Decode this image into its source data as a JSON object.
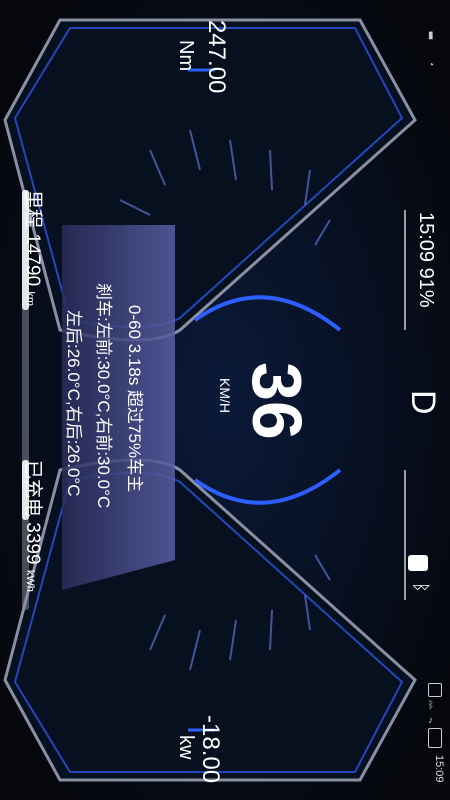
{
  "status_bar": {
    "time": "15:09",
    "icons": [
      "nfc-icon",
      "bluetooth-icon",
      "mute-icon",
      "battery-icon",
      "signal-icon",
      "alarm-icon"
    ]
  },
  "dash": {
    "time_battery": "15:09 91%",
    "gear": "D",
    "speed": "36",
    "speed_unit": "KM/H",
    "torque_value": "247.00",
    "torque_unit": "Nm",
    "power_value": "-18.00",
    "power_unit": "kw",
    "odometer_label": "里程",
    "odometer_value": "14790",
    "odometer_unit": "km",
    "charged_label": "已充电",
    "charged_value": "3399",
    "charged_unit": "kWh",
    "accel_line": "0-60 3.18s 超过75%车主",
    "tire_line_1": "刹车:左前:30.0°C,右前:30.0°C",
    "tire_line_2": "左后:26.0°C,右后:26.0°C"
  },
  "colors": {
    "background": "#05070d",
    "accent_blue": "#2d5fff",
    "panel_purple": "#4a4f8f",
    "frame_grey": "#b8bcc8"
  }
}
